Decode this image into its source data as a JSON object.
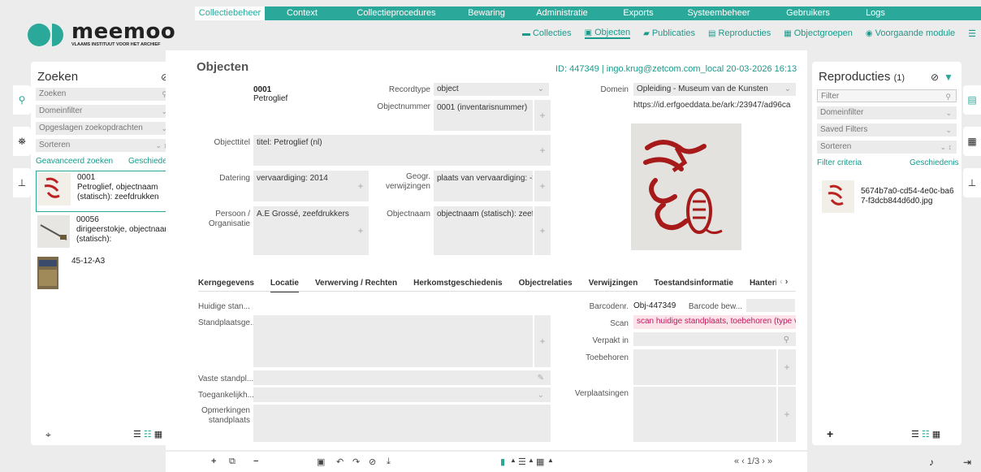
{
  "topnav": [
    "Collectiebeheer",
    "Context",
    "Collectieprocedures",
    "Bewaring",
    "Administratie",
    "Exports",
    "Systeembeheer",
    "Gebruikers",
    "Logs"
  ],
  "logo": {
    "name": "meemoo",
    "sub": "VLAAMS INSTITUUT VOOR HET ARCHIEF"
  },
  "subnav": [
    {
      "icon": "folder-icon",
      "glyph": "▬",
      "label": "Collecties"
    },
    {
      "icon": "image-icon",
      "glyph": "▣",
      "label": "Objecten"
    },
    {
      "icon": "book-icon",
      "glyph": "▰",
      "label": "Publicaties"
    },
    {
      "icon": "film-icon",
      "glyph": "▤",
      "label": "Reproducties"
    },
    {
      "icon": "group-icon",
      "glyph": "▦",
      "label": "Objectgroepen"
    },
    {
      "icon": "back-icon",
      "glyph": "◉",
      "label": "Voorgaande module"
    }
  ],
  "left": {
    "title": "Zoeken",
    "search_placeholder": "Zoeken",
    "domain_filter": "Domeinfilter",
    "saved": "Opgeslagen zoekopdrachten",
    "sort": "Sorteren",
    "advanced": "Geavanceerd zoeken",
    "history": "Geschiedenis",
    "results": [
      {
        "text": "0001\nPetroglief, objectnaam (statisch): zeefdrukken"
      },
      {
        "text": "00056\ndirigeerstokje, objectnaam (statisch):"
      },
      {
        "text": "45-12-A3"
      }
    ]
  },
  "main": {
    "title": "Objecten",
    "meta": "ID: 447349 | ingo.krug@zetcom.com_local 20-03-2026 16:13",
    "record_no": "0001",
    "record_name": "Petroglief",
    "labels": {
      "recordtype": "Recordtype",
      "objectnummer": "Objectnummer",
      "domein": "Domein",
      "objecttitel": "Objecttitel",
      "datering": "Datering",
      "geogr": "Geogr. verwijzingen",
      "persoon": "Persoon / Organisatie",
      "objectnaam": "Objectnaam"
    },
    "values": {
      "recordtype": "object",
      "objectnummer": "0001 (inventarisnummer)",
      "domein": "Opleiding - Museum van de Kunsten",
      "url": "https://id.erfgoeddata.be/ark:/23947/ad96ca",
      "objecttitel": "titel: Petroglief (nl)",
      "datering": "vervaardiging: 2014",
      "geogr": "plaats van vervaardiging: ->",
      "persoon": "A.E Grossé, zeefdrukkers",
      "objectnaam": "objectnaam (statisch): zeefd"
    },
    "tabs": [
      "Kerngegevens",
      "Locatie",
      "Verwerving / Rechten",
      "Herkomstgeschiedenis",
      "Objectrelaties",
      "Verwijzingen",
      "Toestandsinformatie",
      "Hanterin"
    ],
    "loc_labels": {
      "huidige": "Huidige stan...",
      "standplaatsge": "Standplaatsge...",
      "vaste": "Vaste standpl...",
      "toegank": "Toegankelijkh...",
      "opmerk": "Opmerkingen standplaats",
      "barcode": "Barcodenr.",
      "barcode_val": "Obj-447349",
      "barcode_bew": "Barcode bew...",
      "scan": "Scan",
      "scan_val": "scan huidige standplaats, toebehoren (type v",
      "verpakt": "Verpakt in",
      "toebehoren": "Toebehoren",
      "verplaats": "Verplaatsingen"
    },
    "pager": "« ‹ 1/3 › »"
  },
  "right": {
    "title": "Reproducties",
    "count": "(1)",
    "filter_placeholder": "Filter",
    "domain_filter": "Domeinfilter",
    "saved": "Saved Filters",
    "sort": "Sorteren",
    "criteria": "Filter criteria",
    "history": "Geschiedenis",
    "file": "5674b7a0-cd54-4e0c-ba67-f3dcb844d6d0.jpg"
  },
  "colors": {
    "accent": "#2aa89a",
    "scan_bg": "#fbe3ea",
    "scan_text": "#c2185b"
  }
}
